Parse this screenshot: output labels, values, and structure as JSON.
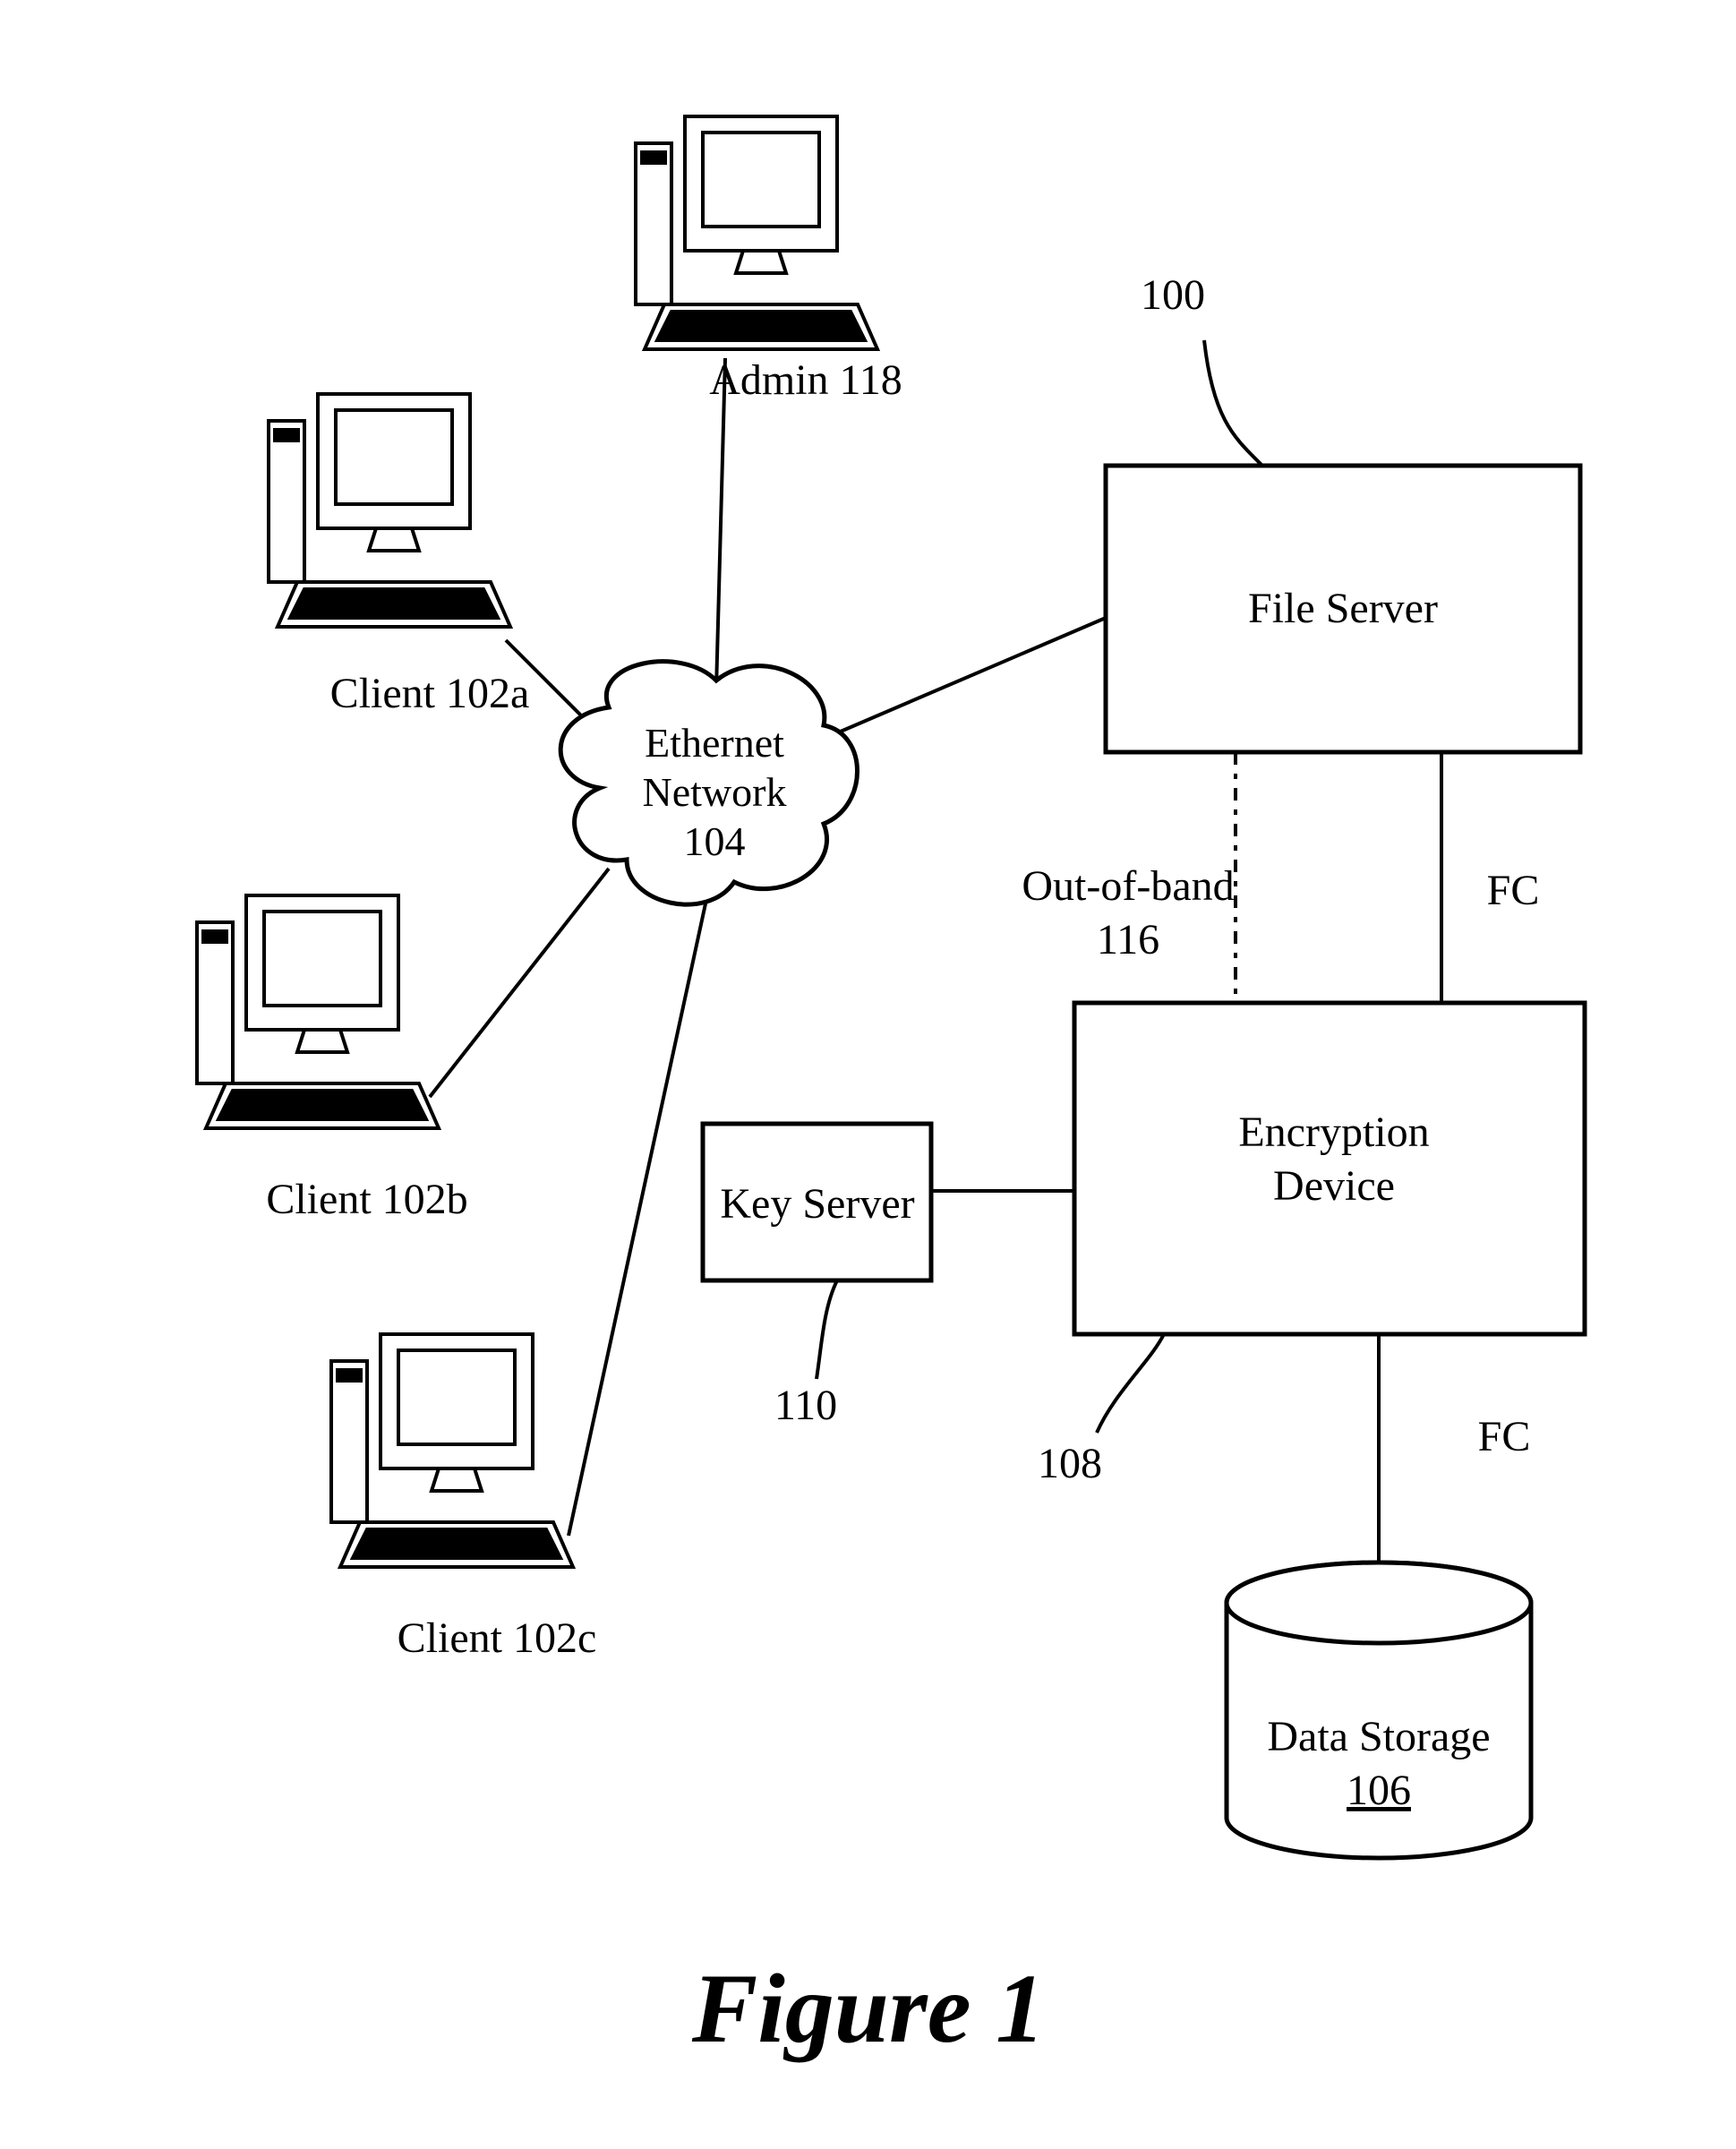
{
  "figure": {
    "caption": "Figure 1",
    "ref_100": "100",
    "admin": {
      "label": "Admin 118"
    },
    "client_a": {
      "label": "Client 102a"
    },
    "client_b": {
      "label": "Client 102b"
    },
    "client_c": {
      "label": "Client 102c"
    },
    "network": {
      "line1": "Ethernet",
      "line2": "Network",
      "line3": "104"
    },
    "file_server": {
      "label": "File Server"
    },
    "encryption_device": {
      "line1": "Encryption",
      "line2": "Device"
    },
    "key_server": {
      "label": "Key Server",
      "ref": "110"
    },
    "encryption_ref": "108",
    "data_storage": {
      "line1": "Data Storage",
      "line2": "106"
    },
    "links": {
      "out_of_band": {
        "line1": "Out-of-band",
        "line2": "116"
      },
      "fc_top": "FC",
      "fc_bottom": "FC"
    }
  }
}
